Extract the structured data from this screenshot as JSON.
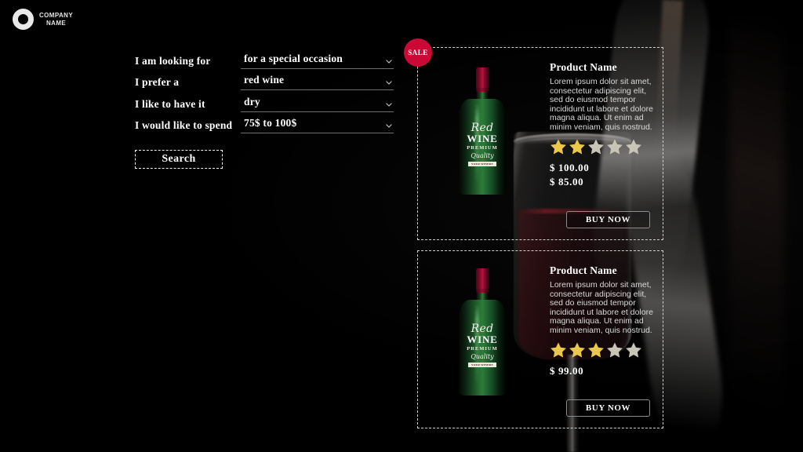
{
  "brand": {
    "logo_icon": "ring-logo-icon",
    "line1": "COMPANY",
    "line2": "NAME"
  },
  "search_form": {
    "fields": [
      {
        "label": "I am looking for",
        "value": "for a special occasion",
        "icon": "chevron-down-icon"
      },
      {
        "label": "I prefer a",
        "value": "red wine",
        "icon": "chevron-down-icon"
      },
      {
        "label": "I like to have it",
        "value": "dry",
        "icon": "chevron-down-icon"
      },
      {
        "label": "I would like to spend",
        "value": "75$ to 100$",
        "icon": "chevron-down-icon"
      }
    ],
    "submit_label": "Search"
  },
  "bottle_label": {
    "script_top": "Red",
    "wine": "WINE",
    "premium": "PREMIUM",
    "quality": "Quality",
    "banner": "YOUR WINERY"
  },
  "products": [
    {
      "badge": "SALE",
      "name": "Product Name",
      "description": "Lorem ipsum dolor sit amet, consectetur adipiscing elit, sed do eiusmod tempor incididunt ut labore et dolore magna aliqua. Ut enim ad minim veniam, quis nostrud.",
      "rating": 2,
      "rating_max": 5,
      "price_old": "$ 100.00",
      "price_new": "$ 85.00",
      "cta_label": "BUY NOW"
    },
    {
      "badge": null,
      "name": "Product Name",
      "description": "Lorem ipsum dolor sit amet, consectetur adipiscing elit, sed do eiusmod tempor incididunt ut labore et dolore magna aliqua. Ut enim ad minim veniam, quis nostrud.",
      "rating": 3,
      "rating_max": 5,
      "price_old": "$ 99.00",
      "price_new": null,
      "cta_label": "BUY NOW"
    }
  ],
  "colors": {
    "background": "#000000",
    "sale_badge": "#cc0936",
    "star_filled": "#e9c84b",
    "star_empty": "#c9c5b6",
    "text_primary": "#ffffff",
    "text_secondary": "#d9d9d9",
    "card_border": "#cfcfcf"
  }
}
